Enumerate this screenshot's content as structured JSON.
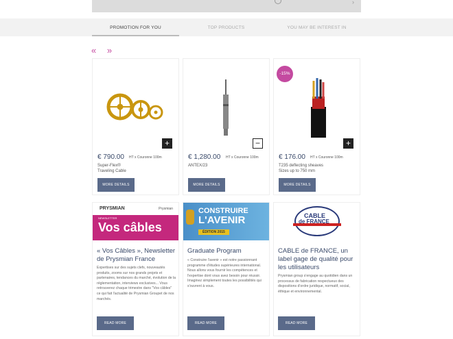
{
  "tabs": [
    {
      "label": "PROMOTION FOR YOU",
      "active": true
    },
    {
      "label": "TOP PRODUCTS",
      "active": false
    },
    {
      "label": "YOU MAY BE INTEREST IN",
      "active": false
    }
  ],
  "pager": {
    "prev": "«",
    "next": "»"
  },
  "products": [
    {
      "price": "€ 790.00",
      "unit": "HT x Couronne 100m",
      "name": "Super-Flex®",
      "name2": "Traveling Cable",
      "button": "MORE DETAILS",
      "toggle": "+"
    },
    {
      "price": "€ 1,280.00",
      "unit": "HT x Couronne 100m",
      "name": "ANTEX/23",
      "name2": "",
      "button": "MORE DETAILS",
      "toggle": "−"
    },
    {
      "price": "€ 176.00",
      "unit": "HT x Couronne 100m",
      "name": "T235 deflecting sheaves",
      "name2": "Sizes up to 750 mm",
      "button": "MORE DETAILS",
      "toggle": "+",
      "badge": "-15%"
    }
  ],
  "news": [
    {
      "brand": "PRYSMIAN",
      "brand_sub": "Prysmian",
      "banner_tag": "NEWSLETTER",
      "banner": "Vos câbles",
      "title": "« Vos Câbles », Newsletter de Prysmian France",
      "body": "Expertises sur des sujets clefs, nouveautés produits, zooms sur nos grands projets et partenaires, tendances du marché, évolution de la réglementation, interviews exclusives... Vous retrouverez chaque trimestre dans \"Vos câbles\" ce qui fait l'actualité de Prysmian Groupet de nos marchés.",
      "button": "READ MORE"
    },
    {
      "banner_line1": "CONSTRUIRE",
      "banner_line2": "L'AVENIR",
      "banner_tag": "ÉDITION 2015",
      "title": "Graduate Program",
      "body": "« Construire l'avenir » est notre passionnant programme d'études supérieures international. Nous allons vous fournir les compétences et l'expertise dont vous avez besoin pour réussir. Imaginez simplement toutes les possibilités qui s'ouvrent à vous.",
      "button": "READ MORE"
    },
    {
      "logo_line1": "CABLE",
      "logo_line2": "de FRANCE",
      "title": "CABLE de FRANCE, un label gage de qualité pour les utilisateurs",
      "body": "Prysmian group s'engage au quotidien dans un processus de fabrication respectueux des dispositions d'ordre juridique, normatif, social, éthique et environnemental.",
      "button": "READ MORE"
    }
  ],
  "colors": {
    "accent": "#c44aa0",
    "button": "#5a6a8a",
    "price": "#3a4a6a"
  }
}
